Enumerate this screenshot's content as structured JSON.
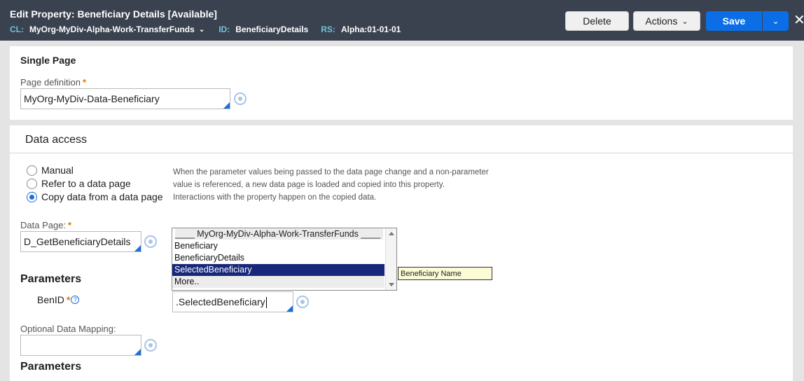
{
  "header": {
    "title": "Edit  Property: Beneficiary Details [Available]",
    "cl_key": "CL:",
    "cl_value": "MyOrg-MyDiv-Alpha-Work-TransferFunds",
    "id_key": "ID:",
    "id_value": "BeneficiaryDetails",
    "rs_key": "RS:",
    "rs_value": "Alpha:01-01-01",
    "delete_label": "Delete",
    "actions_label": "Actions",
    "save_label": "Save"
  },
  "single_page": {
    "title": "Single Page",
    "page_def_label": "Page definition",
    "page_def_value": "MyOrg-MyDiv-Data-Beneficiary"
  },
  "data_access": {
    "title": "Data access",
    "options": [
      {
        "label": "Manual",
        "selected": false
      },
      {
        "label": "Refer to a data page",
        "selected": false
      },
      {
        "label": "Copy data from a data page",
        "selected": true
      }
    ],
    "help_lines": [
      "When the parameter values being passed to the data page change and a non-parameter",
      "value is referenced, a new data page is loaded and copied into this property.",
      "Interactions with the property happen on the copied data."
    ],
    "data_page_label": "Data Page:",
    "data_page_value": "D_GetBeneficiaryDetails",
    "parameters_title": "Parameters",
    "param_name": "BenID",
    "param_value": ".SelectedBeneficiary",
    "optional_mapping_label": "Optional Data Mapping:",
    "optional_mapping_value": "",
    "parameters_title_2": "Parameters"
  },
  "autocomplete": {
    "header": "____ MyOrg-MyDiv-Alpha-Work-TransferFunds ____",
    "items": [
      "Beneficiary",
      "BeneficiaryDetails",
      "SelectedBeneficiary",
      "More.."
    ],
    "selected_index": 2
  },
  "tooltip": {
    "text": "Beneficiary Name"
  }
}
